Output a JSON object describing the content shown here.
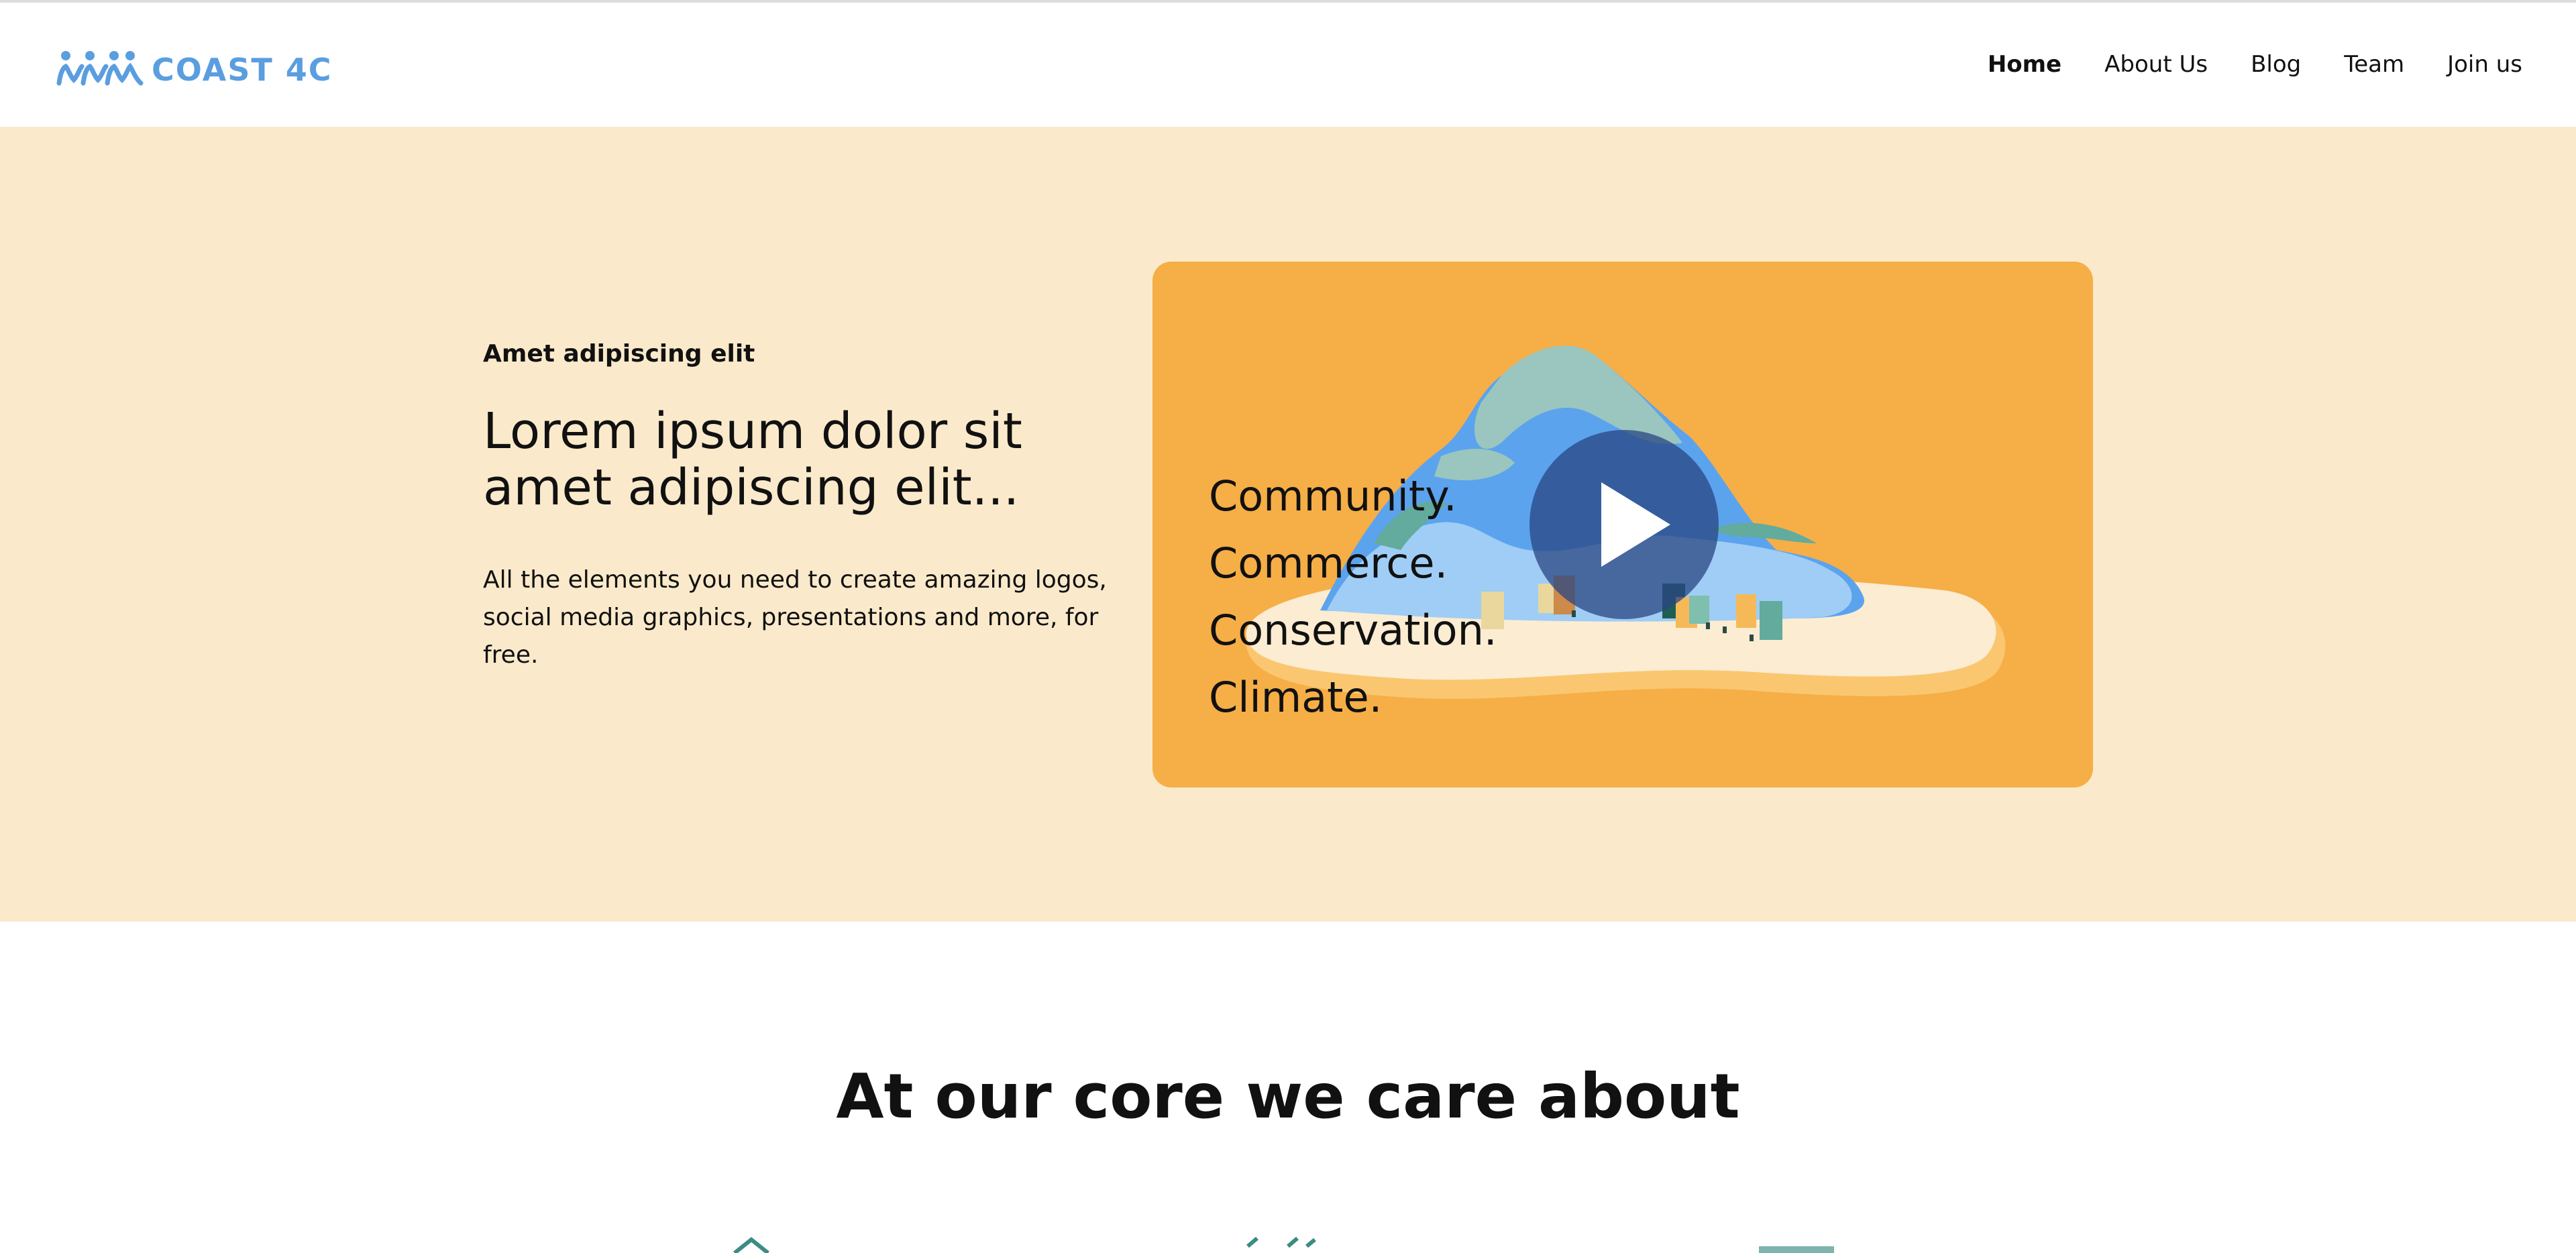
{
  "header": {
    "logo_text": "COAST 4C",
    "logo_color": "#5b9ee0",
    "nav": [
      {
        "label": "Home",
        "active": true
      },
      {
        "label": "About Us",
        "active": false
      },
      {
        "label": "Blog",
        "active": false
      },
      {
        "label": "Team",
        "active": false
      },
      {
        "label": "Join us",
        "active": false
      }
    ]
  },
  "hero": {
    "kicker": "Amet adipiscing elit",
    "headline": "Lorem ipsum dolor sit amet adipiscing elit...",
    "lede": "All the elements you need to create amazing logos, social media graphics, presentations and more, for free.",
    "video": {
      "words": [
        "Community.",
        "Commerce.",
        "Conservation.",
        "Climate."
      ],
      "play_icon": "play-icon",
      "background": "#f6ae47"
    },
    "background": "#faeacb"
  },
  "core": {
    "title_prefix": "At our ",
    "title_bold": "core",
    "title_suffix": " we care about"
  }
}
